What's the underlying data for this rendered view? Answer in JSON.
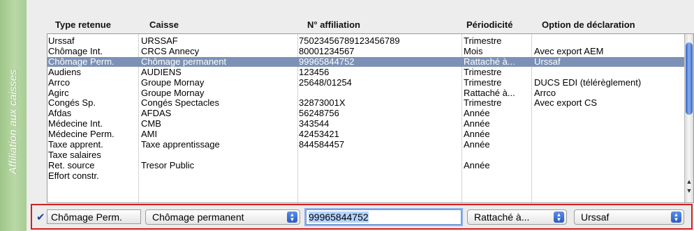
{
  "side_tab": {
    "label": "Affiliation aux caisses"
  },
  "columns": [
    "Type retenue",
    "Caisse",
    "N° affiliation",
    "Périodicité",
    "Option de déclaration"
  ],
  "rows": [
    {
      "type": "Urssaf",
      "caisse": "URSSAF",
      "affiliation": "75023456789123456789",
      "periodicite": "Trimestre",
      "option": ""
    },
    {
      "type": "Chômage Int.",
      "caisse": "CRCS Annecy",
      "affiliation": "80001234567",
      "periodicite": "Mois",
      "option": "Avec export AEM"
    },
    {
      "type": "Chômage Perm.",
      "caisse": "Chômage permanent",
      "affiliation": "99965844752",
      "periodicite": "Rattaché à...",
      "option": "Urssaf",
      "selected": true
    },
    {
      "type": "Audiens",
      "caisse": "AUDIENS",
      "affiliation": "123456",
      "periodicite": "Trimestre",
      "option": ""
    },
    {
      "type": "Arrco",
      "caisse": "Groupe Mornay",
      "affiliation": "25648/01254",
      "periodicite": "Trimestre",
      "option": "DUCS EDI (télérèglement)"
    },
    {
      "type": "Agirc",
      "caisse": "Groupe Mornay",
      "affiliation": "",
      "periodicite": "Rattaché à...",
      "option": "Arrco"
    },
    {
      "type": "Congés Sp.",
      "caisse": "Congés Spectacles",
      "affiliation": "32873001X",
      "periodicite": "Trimestre",
      "option": "Avec export CS"
    },
    {
      "type": "Afdas",
      "caisse": "AFDAS",
      "affiliation": "56248756",
      "periodicite": "Année",
      "option": ""
    },
    {
      "type": "Médecine Int.",
      "caisse": "CMB",
      "affiliation": "343544",
      "periodicite": "Année",
      "option": ""
    },
    {
      "type": "Médecine Perm.",
      "caisse": "AMI",
      "affiliation": "42453421",
      "periodicite": "Année",
      "option": ""
    },
    {
      "type": "Taxe apprent.",
      "caisse": "Taxe apprentissage",
      "affiliation": "844584457",
      "periodicite": "Année",
      "option": ""
    },
    {
      "type": "Taxe salaires",
      "caisse": "",
      "affiliation": "",
      "periodicite": "",
      "option": ""
    },
    {
      "type": "Ret. source",
      "caisse": "Tresor Public",
      "affiliation": "",
      "periodicite": "Année",
      "option": ""
    },
    {
      "type": "Effort constr.",
      "caisse": "",
      "affiliation": "",
      "periodicite": "",
      "option": ""
    }
  ],
  "edit_bar": {
    "check_glyph": "✔",
    "type_label": "Chômage Perm.",
    "caisse_value": "Chômage permanent",
    "affiliation_value": "99965844752",
    "periodicite_value": "Rattaché à...",
    "option_value": "Urssaf"
  },
  "colors": {
    "accent_green": "#a8cd94",
    "selection": "#7c91b5",
    "edit_border": "#d22020",
    "scroll_thumb": "#2f62c7"
  },
  "icons": [
    "checkmark-icon",
    "stepper-arrows-icon",
    "scroll-up-arrow-icon",
    "scroll-down-arrow-icon"
  ]
}
